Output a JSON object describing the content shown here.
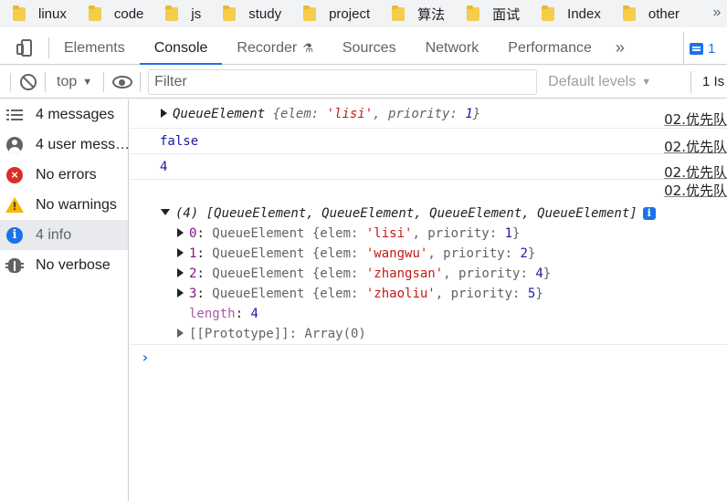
{
  "bookmarks": {
    "items": [
      "linux",
      "code",
      "js",
      "study",
      "project",
      "算法",
      "面试",
      "Index",
      "other"
    ],
    "more_icon": "»"
  },
  "tabs": {
    "items": [
      "Elements",
      "Console",
      "Recorder",
      "Sources",
      "Network",
      "Performance"
    ],
    "active": "Console",
    "more_icon": "»",
    "issues_count": "1"
  },
  "toolbar": {
    "context": "top",
    "filter_placeholder": "Filter",
    "levels": "Default levels",
    "issues": "1 Is"
  },
  "sidebar": {
    "items": [
      {
        "label": "4 messages",
        "icon": "list-icon"
      },
      {
        "label": "4 user mess…",
        "icon": "user-icon"
      },
      {
        "label": "No errors",
        "icon": "error-icon"
      },
      {
        "label": "No warnings",
        "icon": "warning-icon"
      },
      {
        "label": "4 info",
        "icon": "info-icon"
      },
      {
        "label": "No verbose",
        "icon": "bug-icon"
      }
    ],
    "selected_index": 4
  },
  "console": {
    "source": "02.优先队",
    "msg1": {
      "cls": "QueueElement",
      "open": "{",
      "k1": "elem",
      "v1": "'lisi'",
      "k2": "priority",
      "v2": "1",
      "close": "}"
    },
    "msg2": "false",
    "msg3": "4",
    "msg4": {
      "summary": "(4) [QueueElement, QueueElement, QueueElement, QueueElement]",
      "items": [
        {
          "index": "0",
          "elem": "'lisi'",
          "priority": "1"
        },
        {
          "index": "1",
          "elem": "'wangwu'",
          "priority": "2"
        },
        {
          "index": "2",
          "elem": "'zhangsan'",
          "priority": "4"
        },
        {
          "index": "3",
          "elem": "'zhaoliu'",
          "priority": "5"
        }
      ],
      "length_key": "length",
      "length_val": "4",
      "prototype": "[[Prototype]]: Array(0)"
    },
    "prompt": "›"
  }
}
